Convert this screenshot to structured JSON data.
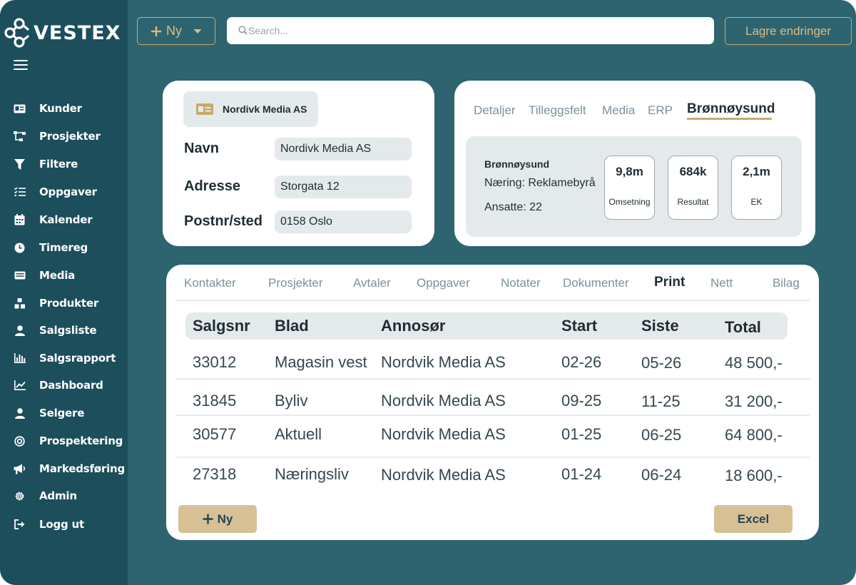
{
  "app": {
    "logo_text": "VESTEX"
  },
  "sidebar": {
    "items": [
      {
        "label": "Kunder",
        "icon": "contact-card-icon"
      },
      {
        "label": "Prosjekter",
        "icon": "project-tree-icon"
      },
      {
        "label": "Filtere",
        "icon": "filter-icon"
      },
      {
        "label": "Oppgaver",
        "icon": "task-list-icon"
      },
      {
        "label": "Kalender",
        "icon": "calendar-icon"
      },
      {
        "label": "Timereg",
        "icon": "clock-icon"
      },
      {
        "label": "Media",
        "icon": "media-icon"
      },
      {
        "label": "Produkter",
        "icon": "products-icon"
      },
      {
        "label": "Salgsliste",
        "icon": "person-icon"
      },
      {
        "label": "Salgsrapport",
        "icon": "bar-chart-icon"
      },
      {
        "label": "Dashboard",
        "icon": "line-chart-icon"
      },
      {
        "label": "Selgere",
        "icon": "person-icon"
      },
      {
        "label": "Prospektering",
        "icon": "target-icon"
      },
      {
        "label": "Markedsføring",
        "icon": "megaphone-icon"
      },
      {
        "label": "Admin",
        "icon": "gear-icon"
      },
      {
        "label": "Logg ut",
        "icon": "logout-icon"
      }
    ]
  },
  "topbar": {
    "new_label": "Ny",
    "search_placeholder": "Search...",
    "save_label": "Lagre endringer"
  },
  "customer": {
    "chip_name": "Nordivk Media AS",
    "fields": [
      {
        "label": "Navn",
        "value": "Nordivk Media AS"
      },
      {
        "label": "Adresse",
        "value": "Storgata 12"
      },
      {
        "label": "Postnr/sted",
        "value": "0158 Oslo"
      }
    ]
  },
  "details": {
    "tabs": [
      "Detaljer",
      "Tilleggsfelt",
      "Media",
      "ERP",
      "Brønnøysund"
    ],
    "active_tab": "Brønnøysund",
    "brreg": {
      "title": "Brønnøysund",
      "industry": "Næring: Reklamebyrå",
      "employees": "Ansatte: 22",
      "stats": [
        {
          "value": "9,8m",
          "label": "Omsetning"
        },
        {
          "value": "684k",
          "label": "Resultat"
        },
        {
          "value": "2,1m",
          "label": "EK"
        }
      ]
    }
  },
  "orders": {
    "tabs": [
      "Kontakter",
      "Prosjekter",
      "Avtaler",
      "Oppgaver",
      "Notater",
      "Dokumenter",
      "Print",
      "Nett",
      "Bilag"
    ],
    "active_tab": "Print",
    "columns": [
      "Salgsnr",
      "Blad",
      "Annosør",
      "Start",
      "Siste",
      "Total"
    ],
    "rows": [
      [
        "33012",
        "Magasin vest",
        "Nordvik Media AS",
        "02-26",
        "05-26",
        "48 500,-"
      ],
      [
        "31845",
        "Byliv",
        "Nordvik Media AS",
        "09-25",
        "11-25",
        "31 200,-"
      ],
      [
        "30577",
        "Aktuell",
        "Nordvik Media AS",
        "01-25",
        "06-25",
        "64 800,-"
      ],
      [
        "27318",
        "Næringsliv",
        "Nordvik Media AS",
        "01-24",
        "06-24",
        "18 600,-"
      ]
    ],
    "new_label": "Ny",
    "excel_label": "Excel"
  },
  "colors": {
    "background": "#2d6470",
    "sidebar": "#1c4e5c",
    "accent_gold": "#c9a96a",
    "button_fill": "#d8c095"
  }
}
